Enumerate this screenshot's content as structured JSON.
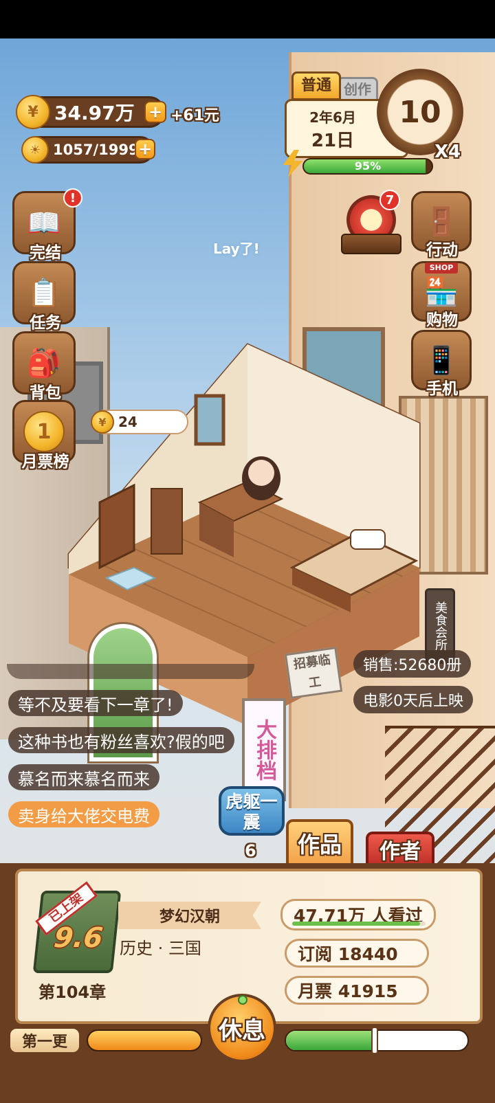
{
  "currency": {
    "coins": "34.97万",
    "income": "+61元",
    "inspiration": "1057/1999"
  },
  "calendar": {
    "mode_tab": "普通",
    "tab2": "创作",
    "year_month": "2年6月",
    "day": "21日",
    "energy_percent": "95%",
    "energy_fraction": 0.95,
    "timer_value": "10",
    "speed": "X4"
  },
  "left_menu": [
    {
      "label": "完结",
      "icon": "book-icon",
      "badge": "!"
    },
    {
      "label": "任务",
      "icon": "clipboard-icon"
    },
    {
      "label": "背包",
      "icon": "bag-icon"
    },
    {
      "label": "月票榜",
      "icon": "medal-icon",
      "medal_text": "1"
    }
  ],
  "right_menu": [
    {
      "label": "行动",
      "icon": "door-icon"
    },
    {
      "label": "购物",
      "icon": "shop-icon",
      "sign": "SHOP"
    },
    {
      "label": "手机",
      "icon": "phone-icon"
    }
  ],
  "wheel_badge": "7",
  "float_text": "Lay了!",
  "room_coin": "24",
  "signs": {
    "recruit": "招募临工",
    "beauty": "美食会所",
    "banner": "大排档"
  },
  "chat_messages": [
    "等不及要看下一章了!",
    "这种书也有粉丝喜欢?假的吧",
    "慕名而来慕名而来",
    "卖身给大佬交电费"
  ],
  "info": {
    "sales": "销售:52680册",
    "movie": "电影0天后上映"
  },
  "boost": {
    "label": "虎躯一震",
    "count": "6"
  },
  "tabs": {
    "works": "作品",
    "author": "作者"
  },
  "book": {
    "status": "已上架",
    "score": "9.6",
    "title": "梦幻汉朝",
    "genre": "历史 · 三国",
    "chapter": "第104章",
    "readers": "47.71万 人看过",
    "readers_fraction": 0.96,
    "subscribe": "订阅 18440",
    "monthly_votes": "月票 41915"
  },
  "bottom": {
    "update_label": "第一更",
    "rest_button": "休息",
    "left_progress": 1.0,
    "right_progress": 0.5
  }
}
